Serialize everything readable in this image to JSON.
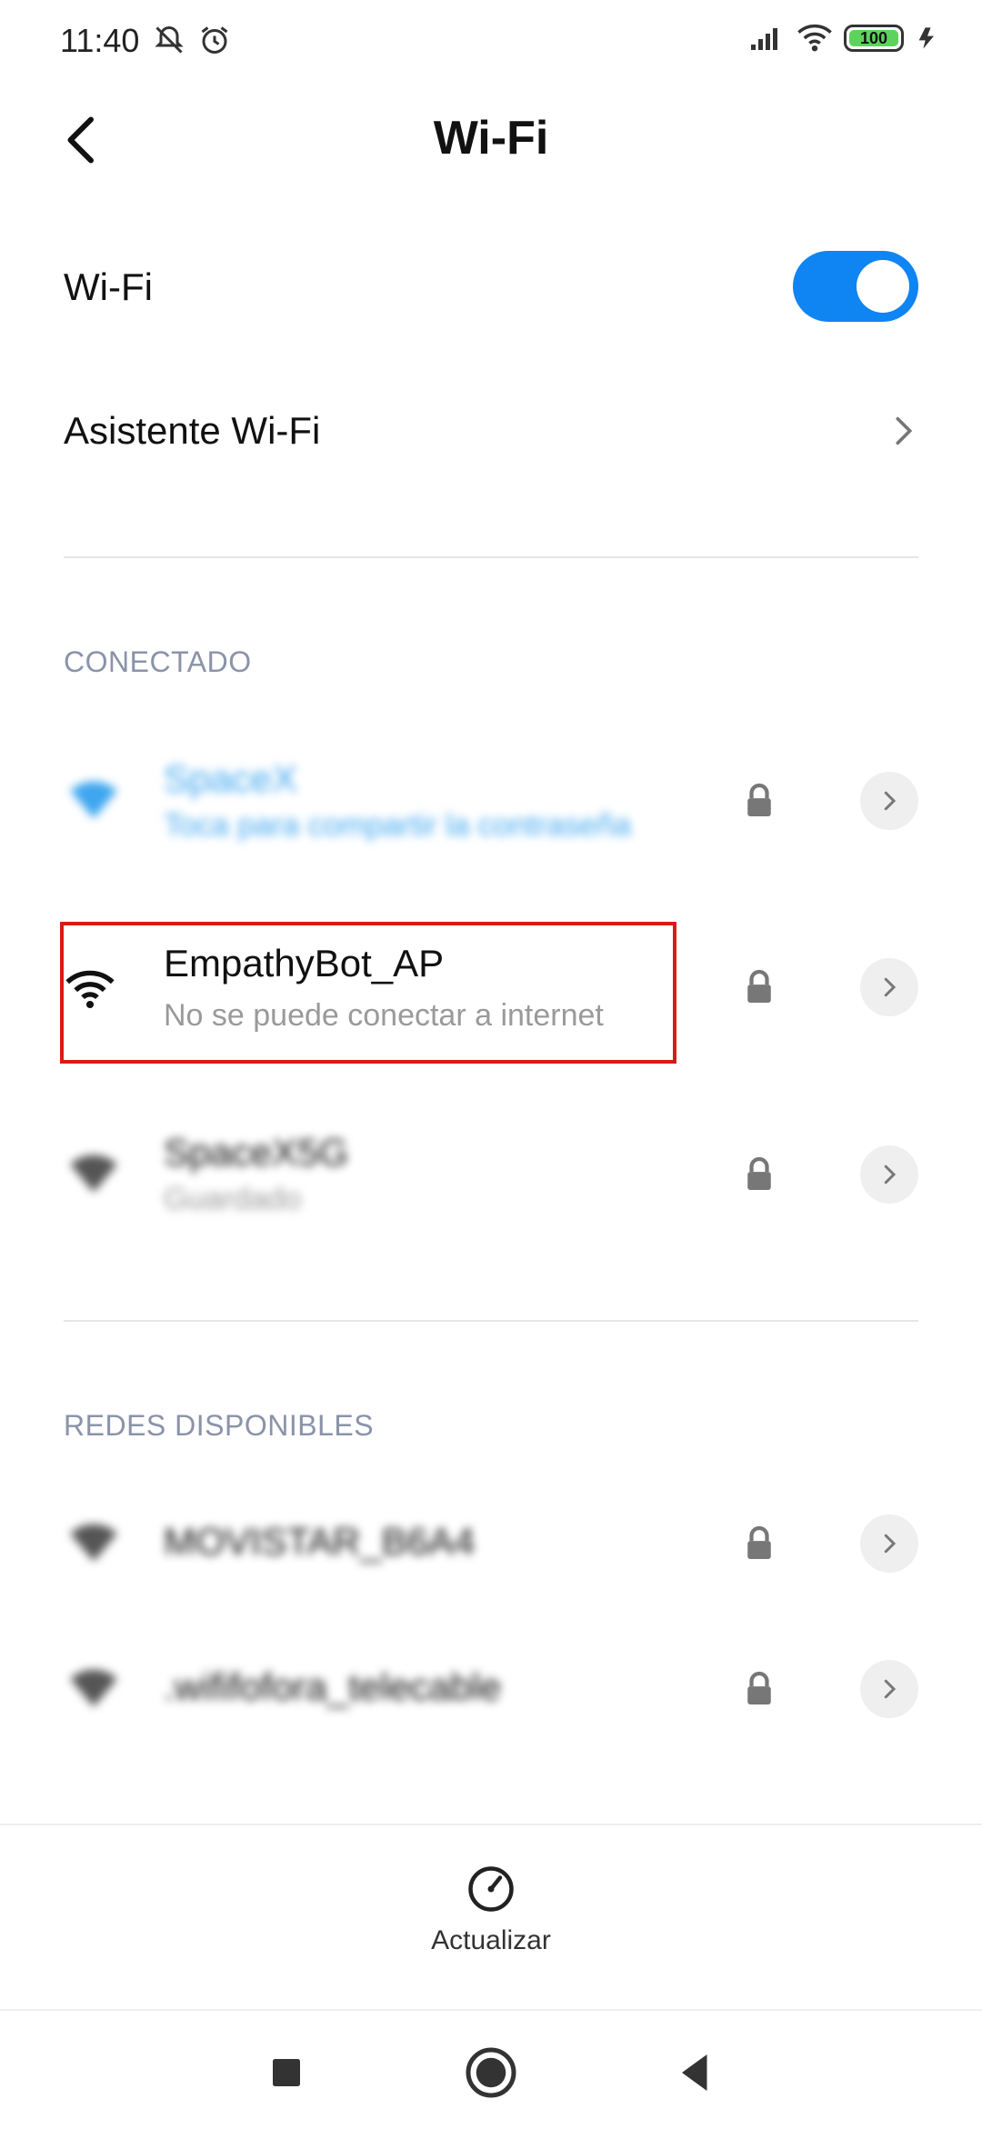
{
  "status_bar": {
    "time": "11:40",
    "battery": "100",
    "accent_battery": "#5dd35d"
  },
  "header": {
    "title": "Wi-Fi"
  },
  "wifi_toggle": {
    "label": "Wi-Fi",
    "state": "on",
    "color": "#0f84f3"
  },
  "assistant": {
    "label": "Asistente Wi-Fi"
  },
  "sections": {
    "connected": "CONECTADO",
    "available": "REDES DISPONIBLES"
  },
  "connected_networks": [
    {
      "name": "SpaceX",
      "status": "Toca para compartir la contraseña"
    },
    {
      "name": "EmpathyBot_AP",
      "status": "No se puede conectar a internet"
    },
    {
      "name": "SpaceX5G",
      "status": "Guardado"
    }
  ],
  "available_networks": [
    {
      "name": "MOVISTAR_B6A4"
    },
    {
      "name": ".wififofora_telecable"
    }
  ],
  "bottom_action": {
    "label": "Actualizar"
  }
}
